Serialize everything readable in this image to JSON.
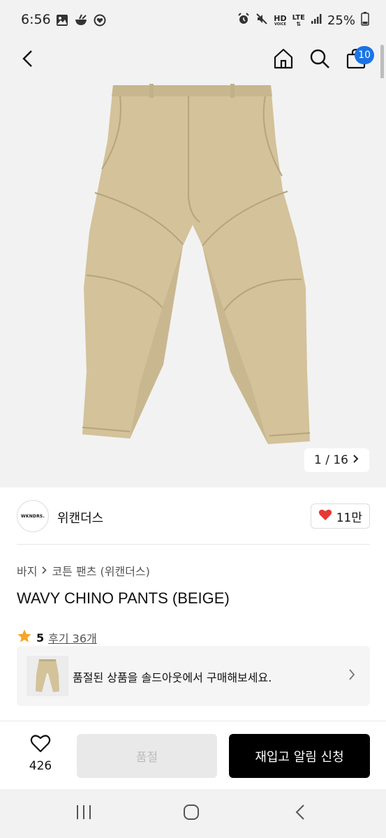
{
  "status_bar": {
    "time": "6:56",
    "battery": "25%",
    "network_hd": "HD",
    "network_lte": "LTE",
    "left_icons": [
      "gallery-icon",
      "bowl-icon",
      "heart-circle-icon"
    ],
    "right_icons": [
      "alarm-icon",
      "mute-icon",
      "hd-voice-icon",
      "lte-icon",
      "signal-icon",
      "battery-icon"
    ]
  },
  "header": {
    "back_icon": "chevron-left-icon",
    "home_icon": "home-icon",
    "search_icon": "search-icon",
    "cart_icon": "shopping-bag-icon",
    "cart_count": "10"
  },
  "gallery": {
    "image_alt": "beige chino pants",
    "counter": "1 / 16",
    "colors": {
      "background": "#f2f2f2",
      "pants": "#d3c29a"
    }
  },
  "brand": {
    "logo_text": "WKNDRS.",
    "name": "위캔더스",
    "like_count": "11만",
    "like_color": "#e53935"
  },
  "breadcrumb": {
    "items": [
      "바지",
      "코튼 팬츠 (위캔더스)"
    ]
  },
  "product": {
    "title": "WAVY CHINO PANTS (BEIGE)",
    "rating": "5",
    "review_text": "후기 36개",
    "star_color": "#f5a623"
  },
  "soldout_notice": {
    "text": "품절된 상품을 솔드아웃에서 구매해보세요."
  },
  "bottom_bar": {
    "wish_count": "426",
    "soldout_label": "품절",
    "restock_label": "재입고 알림 신청"
  },
  "nav_bar": {
    "icons": [
      "recent-apps-icon",
      "home-circle-icon",
      "back-icon"
    ]
  }
}
